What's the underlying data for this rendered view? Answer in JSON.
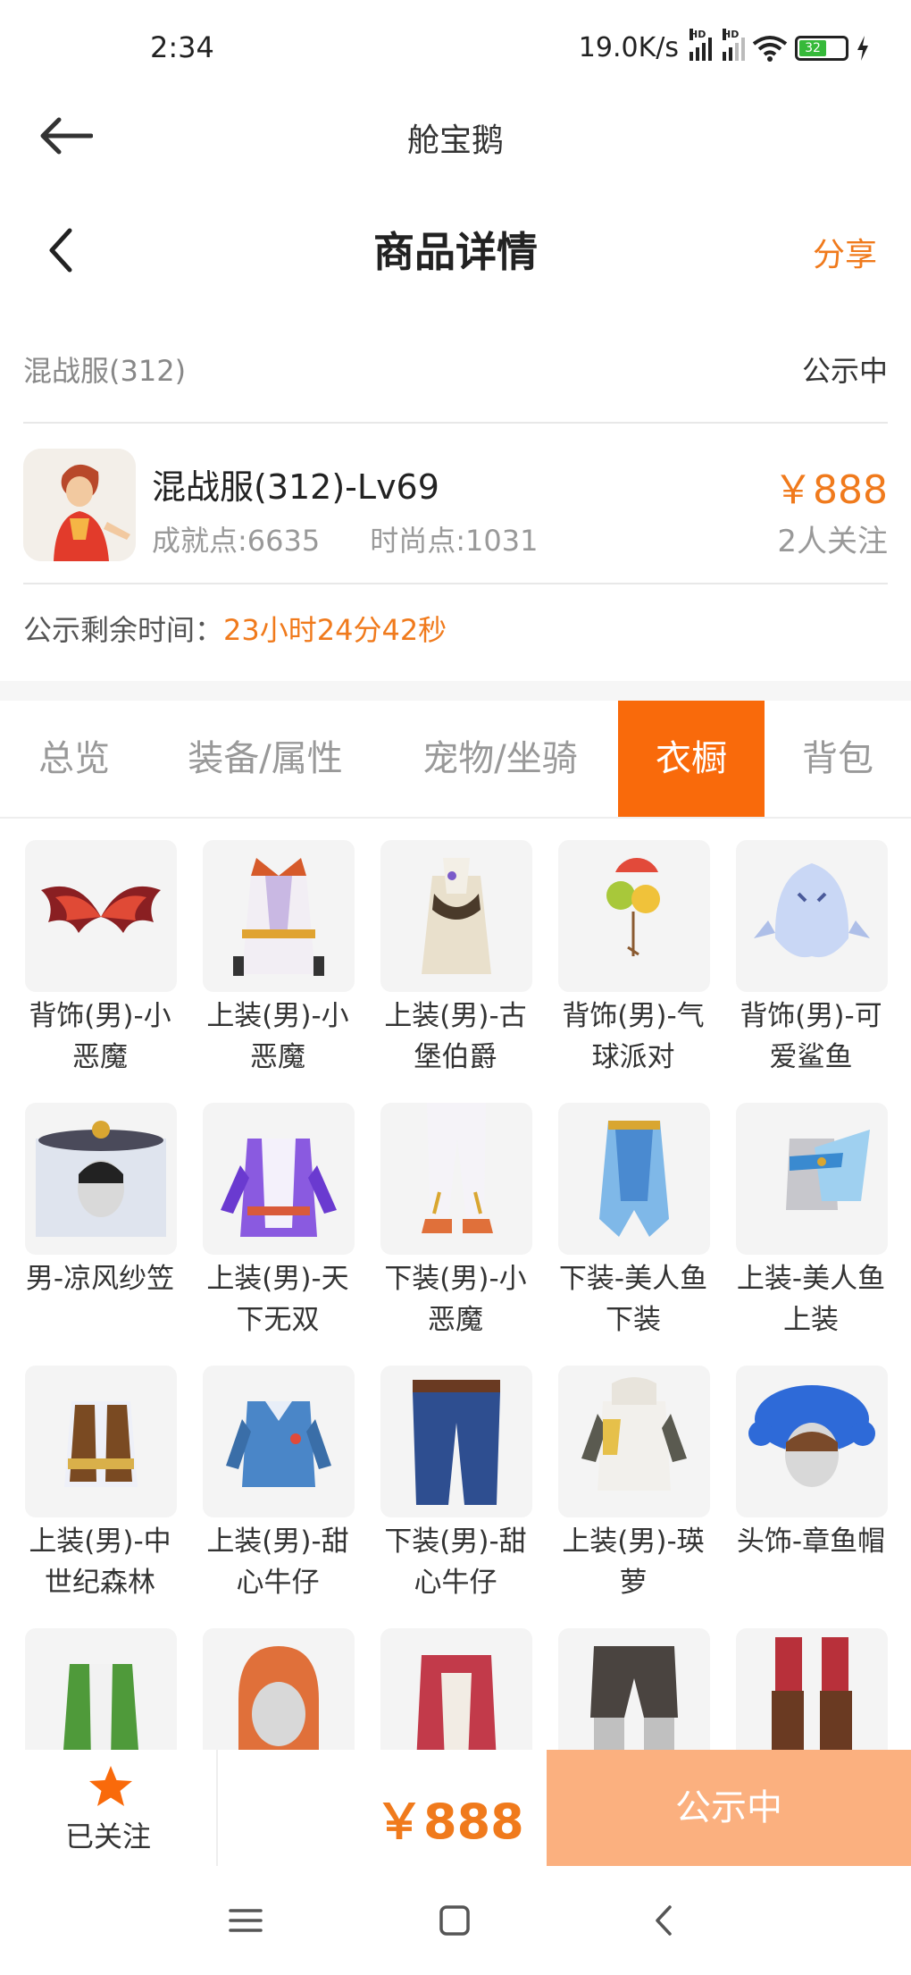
{
  "status_bar": {
    "time": "2:34",
    "network_speed": "19.0K/s",
    "signal_badge": "HD",
    "battery": "32"
  },
  "app_bar": {
    "title": "舱宝鹅"
  },
  "nav": {
    "title": "商品详情",
    "share": "分享"
  },
  "server": {
    "name": "混战服(312)",
    "status": "公示中"
  },
  "item": {
    "title": "混战服(312)-Lv69",
    "achievement": "成就点:6635",
    "fashion": "时尚点:1031",
    "price": "￥888",
    "followers": "2人关注"
  },
  "timer": {
    "label": "公示剩余时间：",
    "value": "23小时24分42秒"
  },
  "tabs": [
    {
      "label": "总览"
    },
    {
      "label": "装备/属性"
    },
    {
      "label": "宠物/坐骑"
    },
    {
      "label": "衣橱"
    },
    {
      "label": "背包"
    }
  ],
  "active_tab": "衣橱",
  "wardrobe": [
    {
      "label": "背饰(男)-小恶魔",
      "icon": "devil-wings-icon"
    },
    {
      "label": "上装(男)-小恶魔",
      "icon": "devil-top-icon"
    },
    {
      "label": "上装(男)-古堡伯爵",
      "icon": "count-top-icon"
    },
    {
      "label": "背饰(男)-气球派对",
      "icon": "balloon-icon"
    },
    {
      "label": "背饰(男)-可爱鲨鱼",
      "icon": "shark-icon"
    },
    {
      "label": "男-凉风纱笠",
      "icon": "veil-hat-icon"
    },
    {
      "label": "上装(男)-天下无双",
      "icon": "purple-top-icon"
    },
    {
      "label": "下装(男)-小恶魔",
      "icon": "white-pants-icon"
    },
    {
      "label": "下装-美人鱼下装",
      "icon": "mermaid-bottom-icon"
    },
    {
      "label": "上装-美人鱼上装",
      "icon": "mermaid-top-icon"
    },
    {
      "label": "上装(男)-中世纪森林",
      "icon": "vest-icon"
    },
    {
      "label": "上装(男)-甜心牛仔",
      "icon": "denim-shirt-icon"
    },
    {
      "label": "下装(男)-甜心牛仔",
      "icon": "jeans-icon"
    },
    {
      "label": "上装(男)-瑛萝",
      "icon": "hoodie-icon"
    },
    {
      "label": "头饰-章鱼帽",
      "icon": "octopus-hat-icon"
    },
    {
      "label": "",
      "icon": "green-jacket-icon"
    },
    {
      "label": "",
      "icon": "orange-hair-icon"
    },
    {
      "label": "",
      "icon": "red-top-icon"
    },
    {
      "label": "",
      "icon": "dark-pants-icon"
    },
    {
      "label": "",
      "icon": "red-boots-icon"
    }
  ],
  "bottom_bar": {
    "follow_label": "已关注",
    "price": "￥888",
    "status_button": "公示中"
  },
  "colors": {
    "accent": "#f07a1c",
    "active_tab": "#f96a0b",
    "status_button": "#fbb07f"
  }
}
